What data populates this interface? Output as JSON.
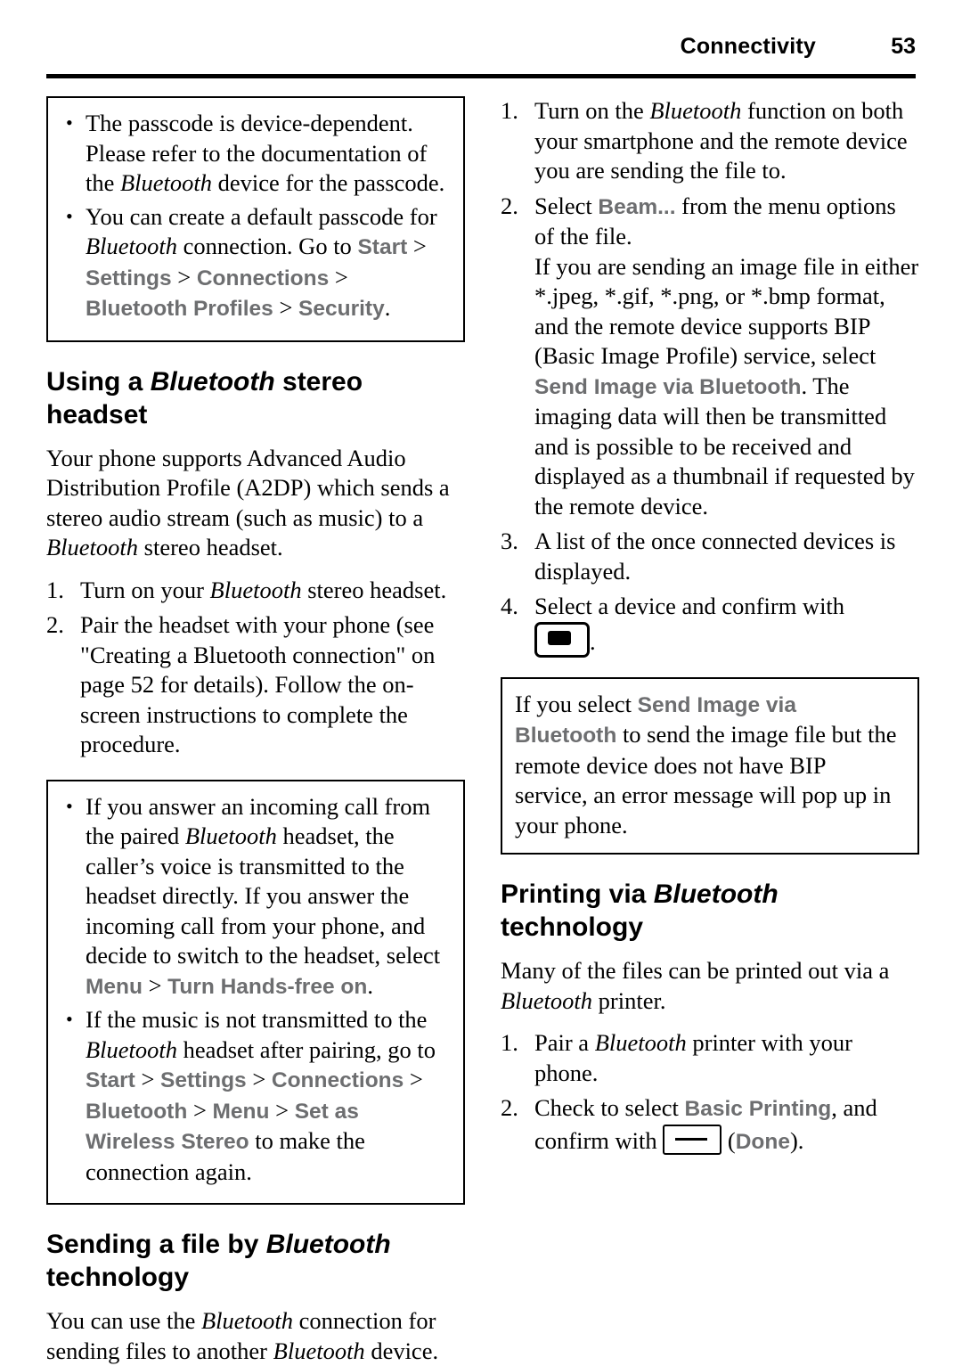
{
  "header": {
    "title": "Connectivity",
    "page_number": "53"
  },
  "left_column": {
    "note_box_1": {
      "bullets": [
        {
          "prefix": "The passcode is device-dependent. Please refer to the documentation of the ",
          "italic": "Bluetooth",
          "suffix": " device for the passcode."
        },
        {
          "prefix": "You can create a default passcode for ",
          "italic": "Bluetooth",
          "mid": " connection. Go to ",
          "ui_path": [
            "Start",
            "Settings",
            "Connections",
            "Bluetooth",
            "Profiles",
            "Security"
          ],
          "suffix": "."
        }
      ]
    },
    "heading_1": {
      "before": "Using a ",
      "italic": "Bluetooth",
      "after": " stereo headset"
    },
    "paragraph_1": {
      "text_1": "Your phone supports Advanced Audio Distribution Profile (A2DP) which sends a stereo audio stream (such as music) to a ",
      "italic": "Bluetooth",
      "text_2": " stereo headset."
    },
    "steps": [
      {
        "num": "1.",
        "text_1": "Turn on your ",
        "italic": "Bluetooth",
        "text_2": " stereo headset."
      },
      {
        "num": "2.",
        "text_1": "Pair the headset with your phone (see \"Creating a Bluetooth connection\" on page 52 for details). Follow the on-screen instructions to complete the procedure."
      }
    ],
    "note_box_2": {
      "bullets": [
        {
          "t1": "If you answer an incoming call from the paired ",
          "i1": "Bluetooth",
          "t2": " headset, the caller’s voice is transmitted to the headset directly. If you answer the incoming call from your phone, and decide to switch to the headset, select ",
          "ui1": "Menu",
          "t3": " > ",
          "ui2": "Turn Hands-free on",
          "t4": "."
        },
        {
          "t1": "If the music is not transmitted to the ",
          "i1": "Bluetooth",
          "t2": " headset after pairing, go to ",
          "ui_path": [
            "Start",
            "Settings",
            "Connections",
            "Bluetooth",
            "Menu",
            "Set as Wireless Stereo"
          ],
          "t3": " to make the connection again."
        }
      ]
    },
    "heading_2": {
      "before": "Sending a file by ",
      "italic": "Bluetooth",
      "after": " technology"
    },
    "paragraph_2": {
      "t1": "You can use the ",
      "i1": "Bluetooth",
      "t2": " connection for sending files to another ",
      "i2": "Bluetooth",
      "t3": " device."
    }
  },
  "right_column": {
    "steps": [
      {
        "num": "1.",
        "t1": "Turn on the ",
        "i1": "Bluetooth",
        "t2": " function on both your smartphone and the remote device you are sending the file to."
      },
      {
        "num": "2.",
        "t1": "Select ",
        "ui1": "Beam...",
        "t2": " from the menu options of the file.",
        "t3": "If you are sending an image file in either *.jpeg, *.gif, *.png, or *.bmp format, and the remote device supports BIP (Basic Image Profile) service, select ",
        "ui2": "Send Image via Bluetooth",
        "t4": ". The imaging data will then be transmitted and is possible to be received and displayed as a thumbnail if requested by the remote device."
      },
      {
        "num": "3.",
        "t1": "A list of the once connected devices is displayed."
      },
      {
        "num": "4.",
        "t1": "Select a device and confirm with ",
        "icon": "ok-key-icon",
        "t2": "."
      }
    ],
    "note_box": {
      "t1": "If you select ",
      "ui1": "Send Image via Bluetooth",
      "t2": " to send the image file but the remote device does not have BIP service, an error message will pop up in your phone."
    },
    "heading": {
      "before": "Printing via ",
      "italic": "Bluetooth",
      "after": " technology"
    },
    "paragraph": {
      "t1": "Many of the files can be printed out via a ",
      "i1": "Bluetooth",
      "t2": " printer."
    },
    "steps_2": [
      {
        "num": "1.",
        "t1": "Pair a ",
        "i1": "Bluetooth",
        "t2": " printer with your phone."
      },
      {
        "num": "2.",
        "t1": "Check to select ",
        "ui1": "Basic Printing",
        "t2": ", and confirm with ",
        "icon": "softkey-icon",
        "t3": " (",
        "ui2": "Done",
        "t4": ")."
      }
    ]
  },
  "colors": {
    "ui_grey": "#6d6e70",
    "text": "#000000"
  }
}
